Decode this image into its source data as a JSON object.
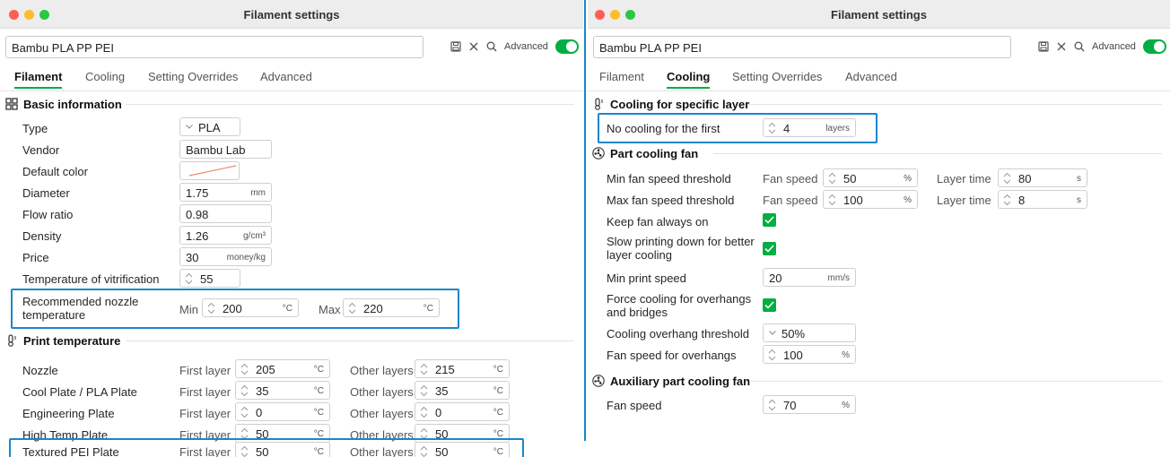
{
  "left": {
    "window_title": "Filament settings",
    "preset_name": "Bambu PLA PP PEI",
    "advanced_label": "Advanced",
    "tabs": [
      "Filament",
      "Cooling",
      "Setting Overrides",
      "Advanced"
    ],
    "active_tab": "Filament",
    "basic_info": {
      "title": "Basic information",
      "type_label": "Type",
      "type_value": "PLA",
      "vendor_label": "Vendor",
      "vendor_value": "Bambu Lab",
      "color_label": "Default color",
      "diameter_label": "Diameter",
      "diameter_value": "1.75",
      "diameter_unit": "mm",
      "flow_label": "Flow ratio",
      "flow_value": "0.98",
      "density_label": "Density",
      "density_value": "1.26",
      "density_unit": "g/cm³",
      "price_label": "Price",
      "price_value": "30",
      "price_unit": "money/kg",
      "vitrification_label": "Temperature of vitrification",
      "vitrification_value": "55",
      "nozzle_label": "Recommended nozzle temperature",
      "min_label": "Min",
      "min_value": "200",
      "max_label": "Max",
      "max_value": "220",
      "temp_unit": "°C"
    },
    "print_temp": {
      "title": "Print temperature",
      "first_label": "First layer",
      "other_label": "Other layers",
      "unit": "°C",
      "rows": [
        {
          "label": "Nozzle",
          "first": "205",
          "other": "215"
        },
        {
          "label": "Cool Plate / PLA Plate",
          "first": "35",
          "other": "35"
        },
        {
          "label": "Engineering Plate",
          "first": "0",
          "other": "0"
        },
        {
          "label": "High Temp Plate",
          "first": "50",
          "other": "50"
        },
        {
          "label": "Textured PEI Plate",
          "first": "50",
          "other": "50"
        }
      ]
    }
  },
  "right": {
    "window_title": "Filament settings",
    "preset_name": "Bambu PLA PP PEI",
    "advanced_label": "Advanced",
    "tabs": [
      "Filament",
      "Cooling",
      "Setting Overrides",
      "Advanced"
    ],
    "active_tab": "Cooling",
    "specific_layer": {
      "title": "Cooling for specific layer",
      "no_cooling_label": "No cooling for the first",
      "no_cooling_value": "4",
      "no_cooling_unit": "layers"
    },
    "part_fan": {
      "title": "Part cooling fan",
      "fan_speed_label": "Fan speed",
      "layer_time_label": "Layer time",
      "min_label": "Min fan speed threshold",
      "min_speed": "50",
      "min_time": "80",
      "max_label": "Max fan speed threshold",
      "max_speed": "100",
      "max_time": "8",
      "pct_unit": "%",
      "sec_unit": "s",
      "keep_on_label": "Keep fan always on",
      "slow_label": "Slow printing down for better layer cooling",
      "min_print_label": "Min print speed",
      "min_print_value": "20",
      "min_print_unit": "mm/s",
      "force_label": "Force cooling for overhangs and bridges",
      "overhang_thr_label": "Cooling overhang threshold",
      "overhang_thr_value": "50%",
      "overhang_fan_label": "Fan speed for overhangs",
      "overhang_fan_value": "100"
    },
    "aux_fan": {
      "title": "Auxiliary part cooling fan",
      "fan_speed_label": "Fan speed",
      "value": "70",
      "unit": "%"
    }
  },
  "colors": {
    "accent": "#00ae42",
    "highlight": "#1a86c9",
    "swatch_line": "#f08a6b"
  },
  "icons": [
    "save-icon",
    "close-icon",
    "search-icon",
    "spin-arrows-icon",
    "chevron-down-icon",
    "grid-icon",
    "thermometer-icon",
    "fan-icon",
    "check-icon"
  ]
}
